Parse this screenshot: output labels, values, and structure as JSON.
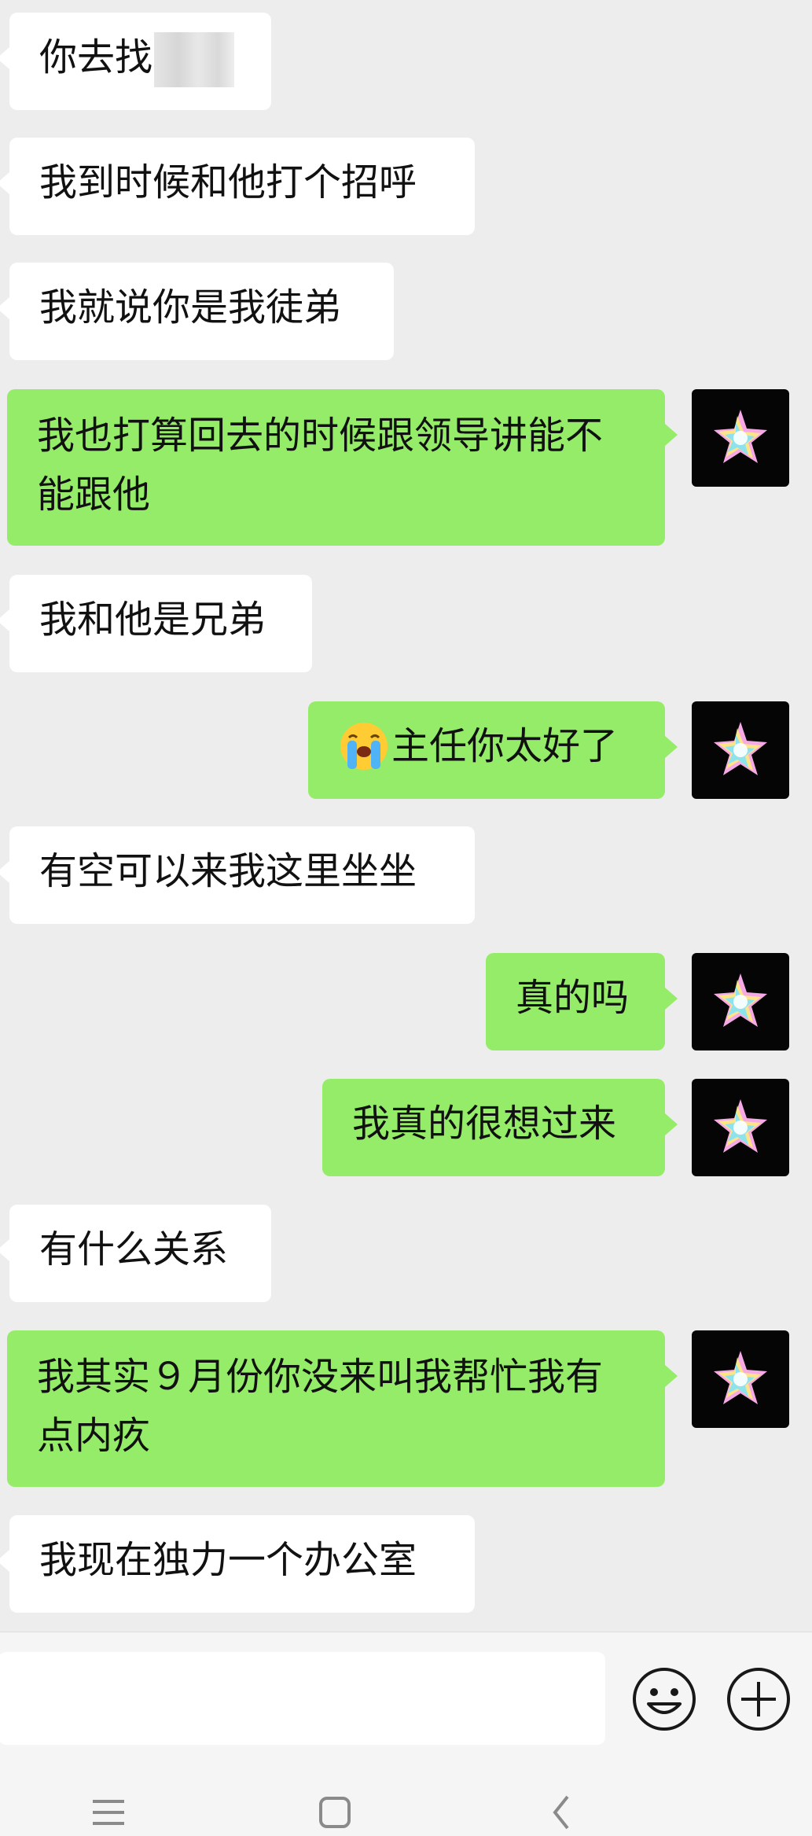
{
  "messages": [
    {
      "side": "left",
      "text": "你去找"
    },
    {
      "side": "left",
      "text": "我到时候和他打个招呼"
    },
    {
      "side": "left",
      "text": "我就说你是我徒弟"
    },
    {
      "side": "right",
      "text": "我也打算回去的时候跟领导讲能不能跟他"
    },
    {
      "side": "left",
      "text": "我和他是兄弟"
    },
    {
      "side": "right",
      "text": "主任你太好了",
      "emoji": "loudly-crying-face-emoji"
    },
    {
      "side": "left",
      "text": "有空可以来我这里坐坐"
    },
    {
      "side": "right",
      "text": "真的吗"
    },
    {
      "side": "right",
      "text": "我真的很想过来"
    },
    {
      "side": "left",
      "text": "有什么关系"
    },
    {
      "side": "right",
      "text": "我其实９月份你没来叫我帮忙我有点内疚"
    },
    {
      "side": "left",
      "text": "我现在独力一个办公室"
    }
  ],
  "input": {
    "value": "",
    "placeholder": ""
  },
  "icons": {
    "avatar": "colorful-star-avatar",
    "emoji_button": "smiley-icon",
    "more_button": "plus-circle-icon",
    "nav_menu": "menu-icon",
    "nav_home": "home-square-icon",
    "nav_back": "back-chevron-icon",
    "redaction": "blurred-name"
  },
  "colors": {
    "background": "#ededed",
    "incoming_bubble": "#ffffff",
    "outgoing_bubble": "#95ec69",
    "text": "#111111"
  }
}
